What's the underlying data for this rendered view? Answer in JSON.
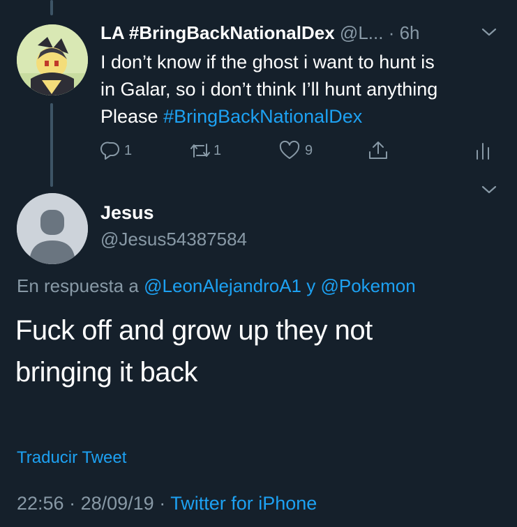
{
  "tweet_parent": {
    "display_name": "LA #BringBackNationalDex",
    "handle": "@L...",
    "time": "· 6h",
    "text_line1": "I don’t know if the ghost i want to hunt is",
    "text_line2": "in Galar, so i don’t think I’ll hunt anything",
    "text_prefix": "Please ",
    "hashtag": "#BringBackNationalDex",
    "reply_count": "1",
    "retweet_count": "1",
    "like_count": "9"
  },
  "tweet_main": {
    "display_name": "Jesus",
    "handle": "@Jesus54387584",
    "reply_prefix": "En respuesta a ",
    "reply_user1": "@LeonAlejandroA1",
    "reply_join": " y ",
    "reply_user2": "@Pokemon",
    "text_line1": "Fuck off and grow up they not",
    "text_line2": "bringing it back",
    "translate_label": "Traducir Tweet",
    "time": "22:56",
    "date": "28/09/19",
    "separator": " · ",
    "source": "Twitter for iPhone"
  },
  "colors": {
    "background": "#15202b",
    "accent": "#1da1f2",
    "secondary_text": "#8899a6"
  },
  "icons": [
    "reply-icon",
    "retweet-icon",
    "like-icon",
    "share-icon",
    "analytics-icon",
    "chevron-down-icon"
  ]
}
